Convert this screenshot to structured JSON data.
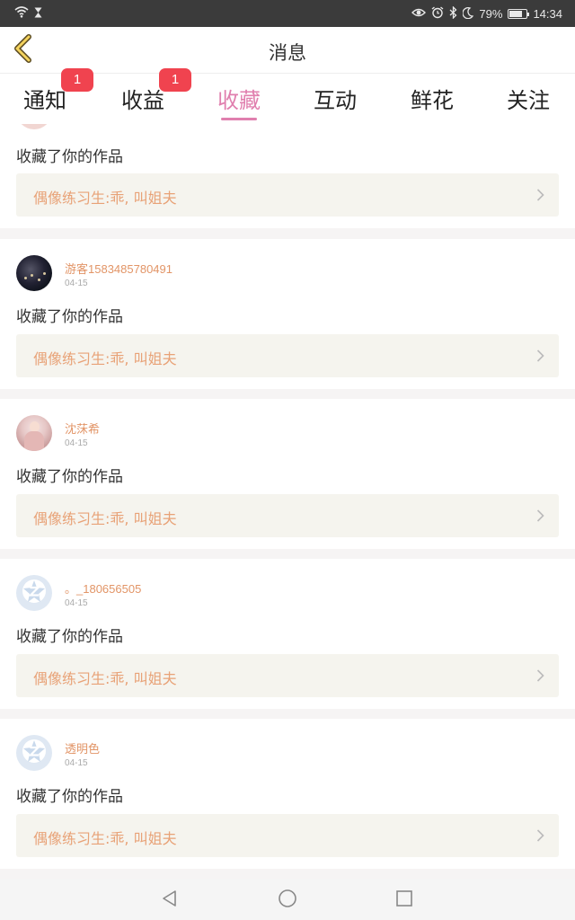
{
  "status_bar": {
    "battery": "79%",
    "battery_level": 0.79,
    "time": "14:34",
    "icons": [
      "wifi-icon",
      "hourglass-icon",
      "eye-icon",
      "alarm-icon",
      "bluetooth-icon",
      "moon-icon",
      "battery-icon"
    ]
  },
  "header": {
    "title": "消息",
    "back_icon": "chevron-left-icon"
  },
  "colors": {
    "accent": "#e07fae",
    "badge": "#f0434f",
    "name": "#e29567",
    "work_title": "#e8a277"
  },
  "tabs": [
    {
      "label": "通知",
      "badge": "1",
      "active": false
    },
    {
      "label": "收益",
      "badge": "1",
      "active": false
    },
    {
      "label": "收藏",
      "badge": null,
      "active": true
    },
    {
      "label": "互动",
      "badge": null,
      "active": false
    },
    {
      "label": "鲜花",
      "badge": null,
      "active": false
    },
    {
      "label": "关注",
      "badge": null,
      "active": false
    }
  ],
  "items": [
    {
      "name": "",
      "date": "",
      "message": "收藏了你的作品",
      "work_title": "偶像练习生:乖, 叫姐夫",
      "avatar": "partial"
    },
    {
      "name": "游客1583485780491",
      "date": "04-15",
      "message": "收藏了你的作品",
      "work_title": "偶像练习生:乖, 叫姐夫",
      "avatar": "dark-photo"
    },
    {
      "name": "沈莯希",
      "date": "04-15",
      "message": "收藏了你的作品",
      "work_title": "偶像练习生:乖, 叫姐夫",
      "avatar": "pink-photo"
    },
    {
      "name": "。_180656505",
      "date": "04-15",
      "message": "收藏了你的作品",
      "work_title": "偶像练习生:乖, 叫姐夫",
      "avatar": "default-z-icon"
    },
    {
      "name": "透明色",
      "date": "04-15",
      "message": "收藏了你的作品",
      "work_title": "偶像练习生:乖, 叫姐夫",
      "avatar": "default-z-icon"
    }
  ],
  "navbar": {
    "icons": [
      "back-triangle-icon",
      "home-circle-icon",
      "recents-square-icon"
    ]
  }
}
